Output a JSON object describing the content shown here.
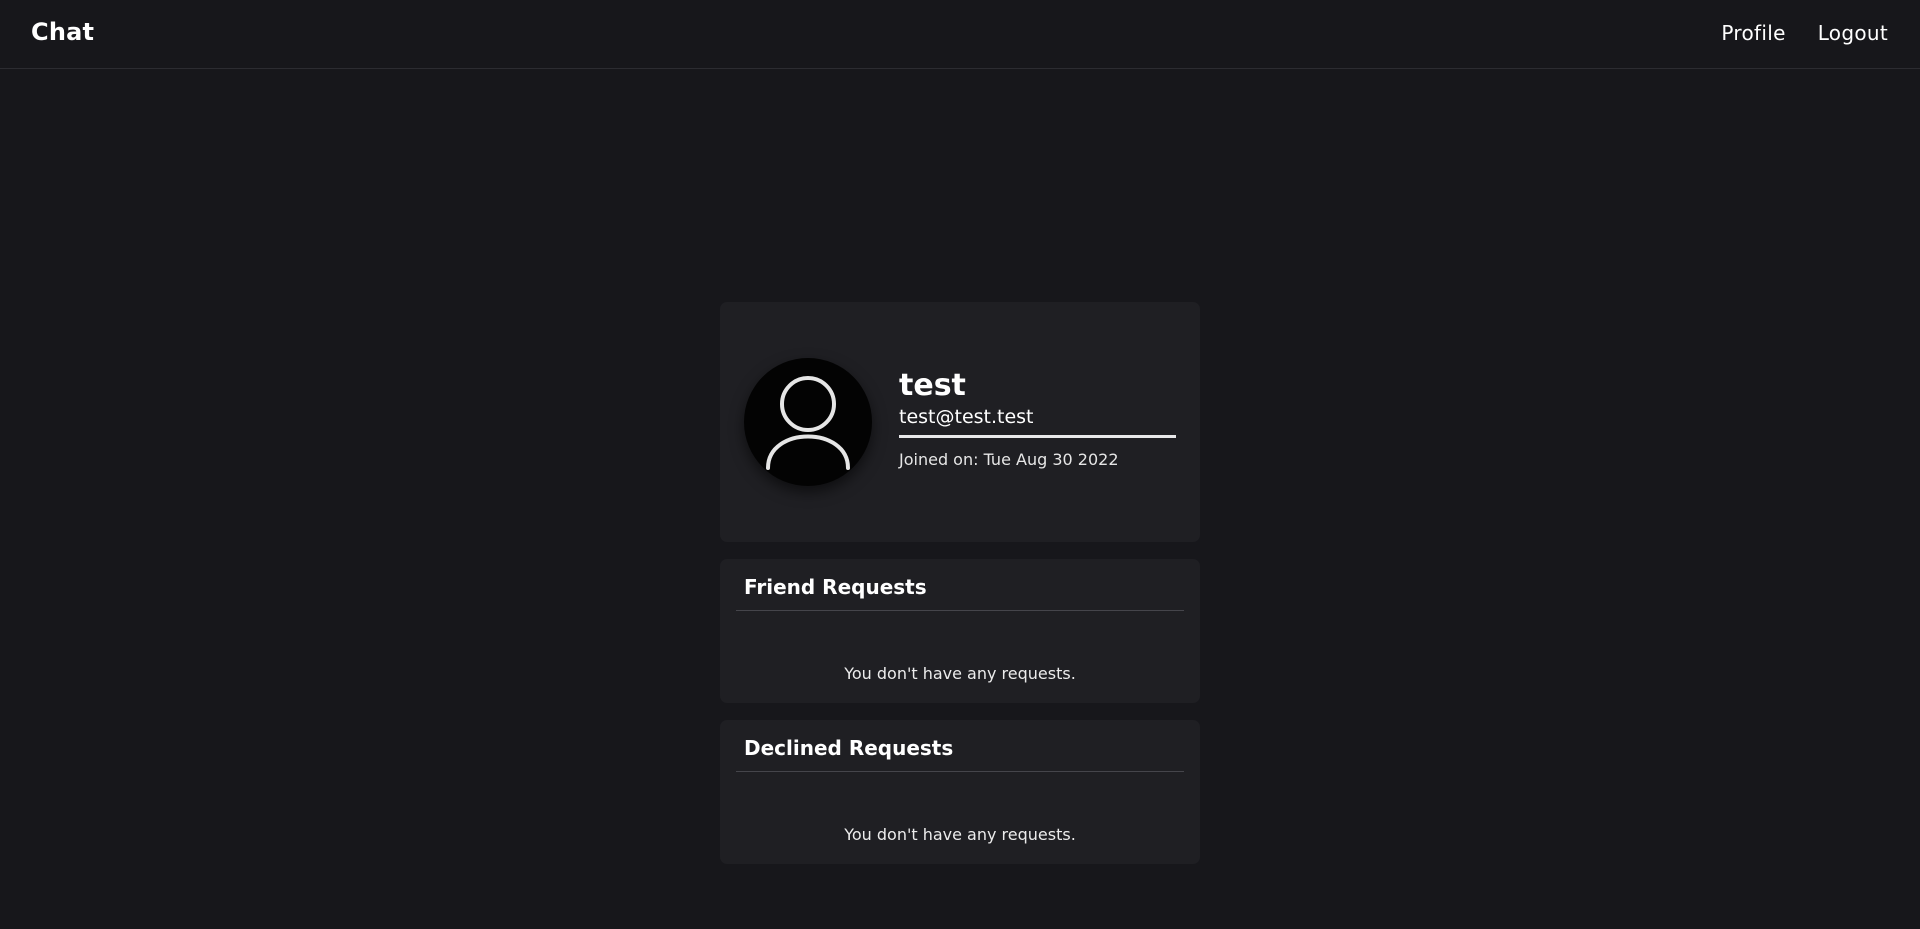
{
  "navbar": {
    "brand": "Chat",
    "links": [
      "Profile",
      "Logout"
    ]
  },
  "profile": {
    "username": "test",
    "email": "test@test.test",
    "joined": "Joined on: Tue Aug 30 2022",
    "avatar_icon": "user-icon"
  },
  "friend_requests": {
    "title": "Friend Requests",
    "empty_message": "You don't have any requests."
  },
  "declined_requests": {
    "title": "Declined Requests",
    "empty_message": "You don't have any requests."
  },
  "colors": {
    "background": "#17171b",
    "card": "#1f1f23",
    "text": "#ffffff"
  }
}
